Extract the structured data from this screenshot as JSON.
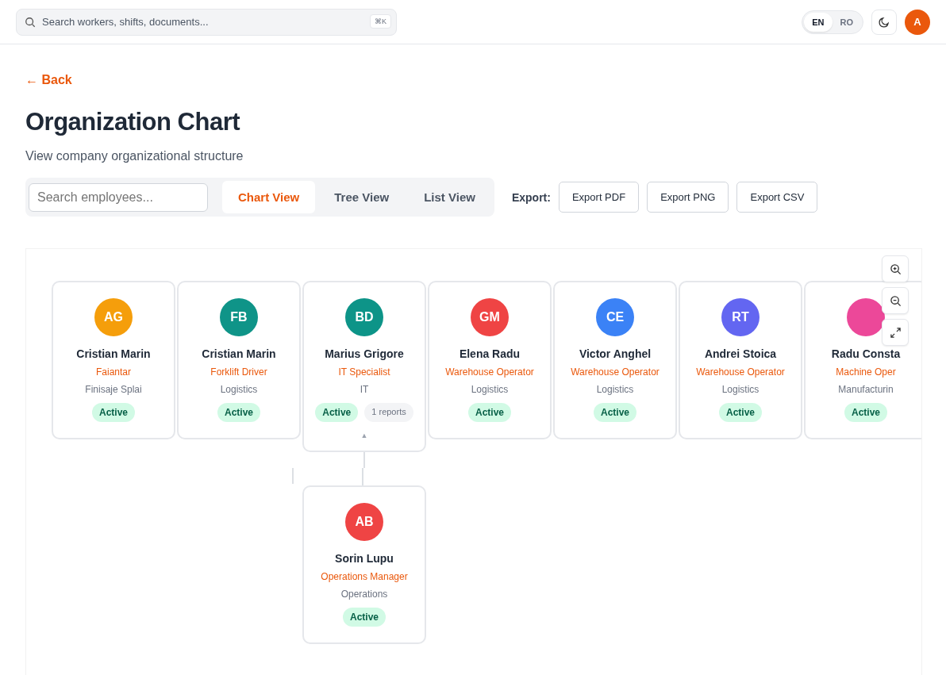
{
  "topbar": {
    "search": {
      "placeholder": "Search workers, shifts, documents...",
      "shortcut": "⌘K"
    },
    "languages": [
      {
        "label": "EN",
        "selected": true
      },
      {
        "label": "RO",
        "selected": false
      }
    ],
    "user_initial": "A"
  },
  "back": "← Back",
  "title": "Organization Chart",
  "subtitle": "View company organizational structure",
  "toolbar": {
    "search": {
      "placeholder": "Search employees..."
    },
    "views": [
      {
        "label": "Chart View",
        "selected": true
      },
      {
        "label": "Tree View",
        "selected": false
      },
      {
        "label": "List View",
        "selected": false
      }
    ],
    "export_label": "Export:",
    "export_buttons": [
      "Export PDF",
      "Export PNG",
      "Export CSV"
    ]
  },
  "employees": [
    {
      "initials": "AG",
      "color": "#f59e0b",
      "name": "Cristian Marin",
      "role": "Faiantar",
      "department": "Finisaje Splai",
      "status": "Active"
    },
    {
      "initials": "FB",
      "color": "#0f9488",
      "name": "Cristian Marin",
      "role": "Forklift Driver",
      "department": "Logistics",
      "status": "Active"
    },
    {
      "initials": "BD",
      "color": "#0d9488",
      "name": "Marius Grigore",
      "role": "IT Specialist",
      "department": "IT",
      "status": "Active",
      "reports": "1 reports",
      "toggle": "▲",
      "expanded": true,
      "children": [
        {
          "initials": "AB",
          "color": "#ef4444",
          "name": "Sorin Lupu",
          "role": "Operations Manager",
          "department": "Operations",
          "status": "Active"
        }
      ]
    },
    {
      "initials": "GM",
      "color": "#ef4444",
      "name": "Elena Radu",
      "role": "Warehouse Operator",
      "department": "Logistics",
      "status": "Active"
    },
    {
      "initials": "CE",
      "color": "#3b82f6",
      "name": "Victor Anghel",
      "role": "Warehouse Operator",
      "department": "Logistics",
      "status": "Active"
    },
    {
      "initials": "RT",
      "color": "#6366f1",
      "name": "Andrei Stoica",
      "role": "Warehouse Operator",
      "department": "Logistics",
      "status": "Active"
    },
    {
      "color": "#ec4899",
      "name": "Radu Consta",
      "role": "Machine Oper",
      "department": "Manufacturin",
      "status": "Active"
    }
  ]
}
